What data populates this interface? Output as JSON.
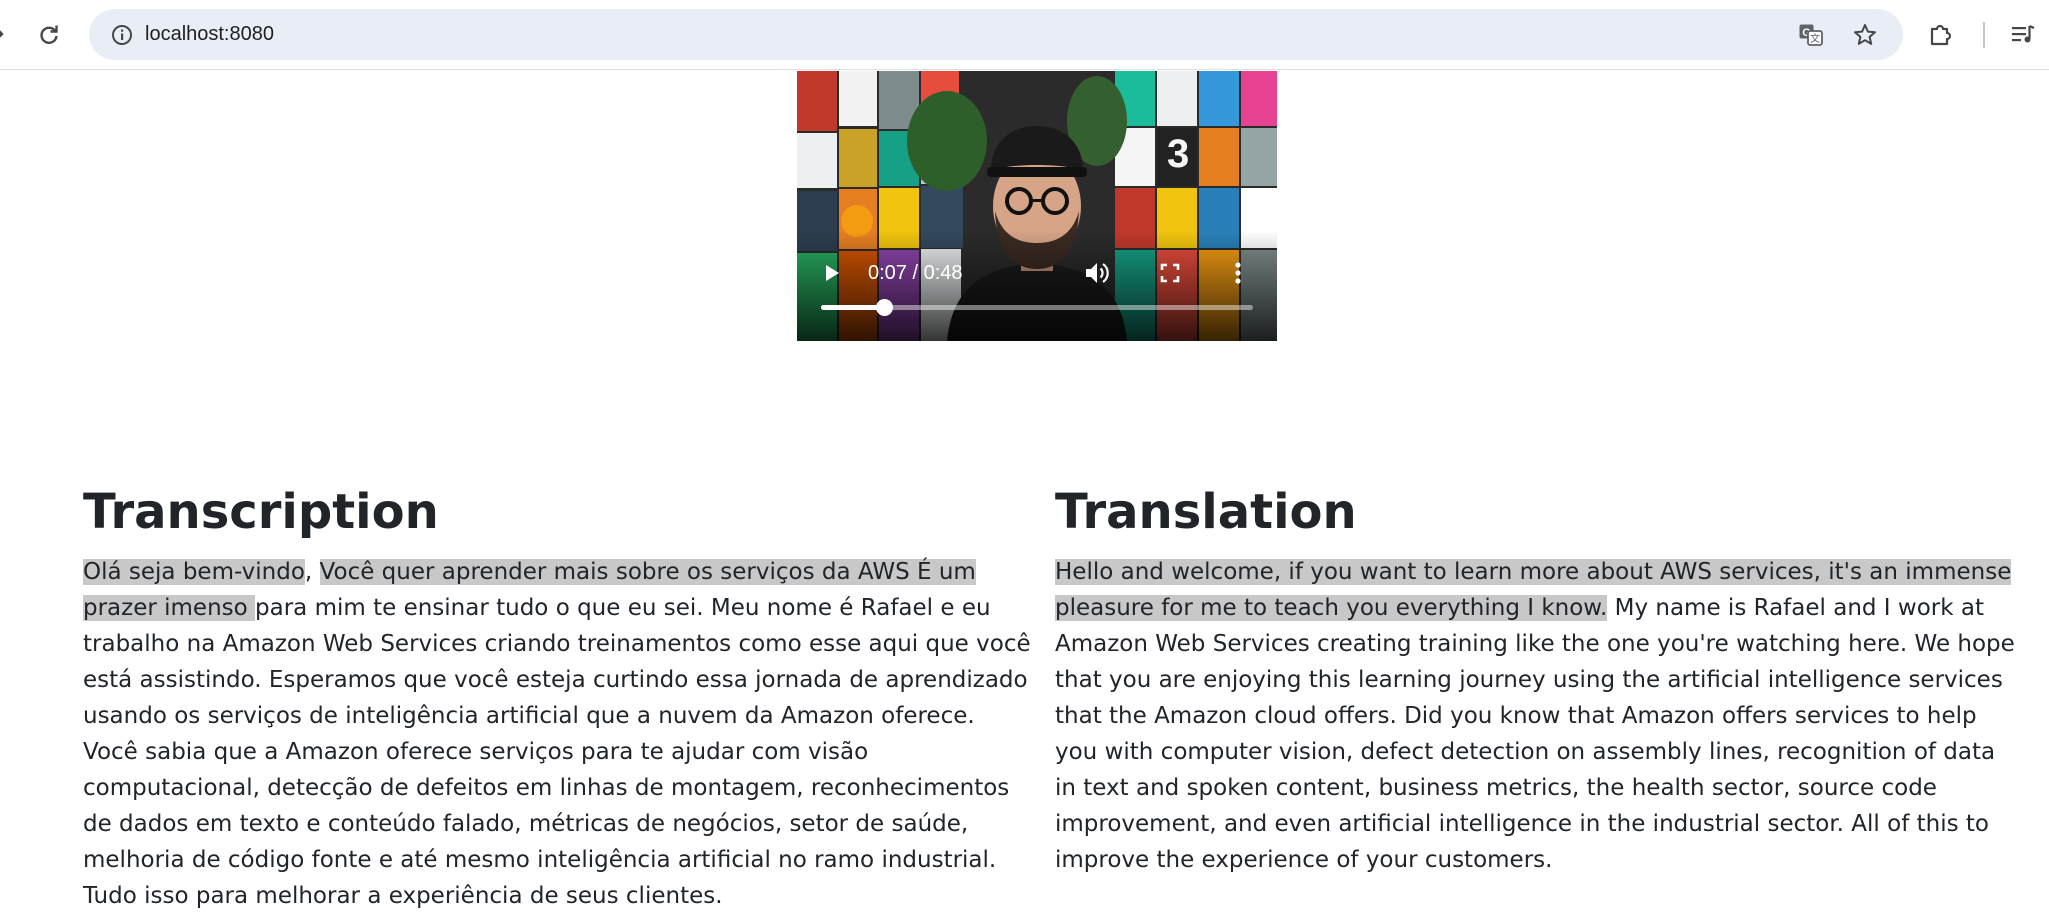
{
  "browser": {
    "url": "localhost:8080",
    "icons": [
      "back-arrow-icon",
      "reload-icon",
      "site-info-icon",
      "translate-icon",
      "star-icon",
      "extensions-icon",
      "reading-list-icon"
    ]
  },
  "video": {
    "current_time": "0:07",
    "duration": "0:48",
    "time_display": "0:07 / 0:48",
    "progress_fraction": 0.146,
    "icons": [
      "play-icon",
      "volume-icon",
      "fullscreen-icon",
      "more-vert-icon"
    ]
  },
  "transcription": {
    "heading": "Transcription",
    "segments": [
      {
        "text": "Olá seja bem-vindo",
        "highlighted": true
      },
      {
        "text": ", ",
        "highlighted": false
      },
      {
        "text": "Você quer aprender mais sobre os serviços da AWS É um prazer imenso ",
        "highlighted": true
      },
      {
        "text": "para mim te ensinar tudo o que eu sei. Meu nome é Rafael e eu trabalho na Amazon Web Services criando treinamentos como esse aqui que você está assistindo. Esperamos que você esteja curtindo essa jornada de aprendizado usando os serviços de inteligência artificial que a nuvem da Amazon oferece. Você sabia que a Amazon oferece serviços para te ajudar com visão computacional, detecção de defeitos em linhas de montagem, reconhecimentos de dados em texto e conteúdo falado, métricas de negócios, setor de saúde, melhoria de código fonte e até mesmo inteligência artificial no ramo industrial. Tudo isso para melhorar a experiência de seus clientes.",
        "highlighted": false
      }
    ]
  },
  "translation": {
    "heading": "Translation",
    "segments": [
      {
        "text": "Hello and welcome, if you want to learn more about AWS services, it's an immense pleasure for me to teach you everything I know.",
        "highlighted": true
      },
      {
        "text": " My name is Rafael and I work at Amazon Web Services creating training like the one you're watching here. We hope that you are enjoying this learning journey using the artificial intelligence services that the Amazon cloud offers. Did you know that Amazon offers services to help you with computer vision, defect detection on assembly lines, recognition of data in text and spoken content, business metrics, the health sector, source code improvement, and even artificial intelligence in the industrial sector. All of this to improve the experience of your customers.",
        "highlighted": false
      }
    ]
  },
  "colors": {
    "highlight": "#c8c8c8",
    "omnibox": "#e9eef6",
    "text": "#212529"
  }
}
